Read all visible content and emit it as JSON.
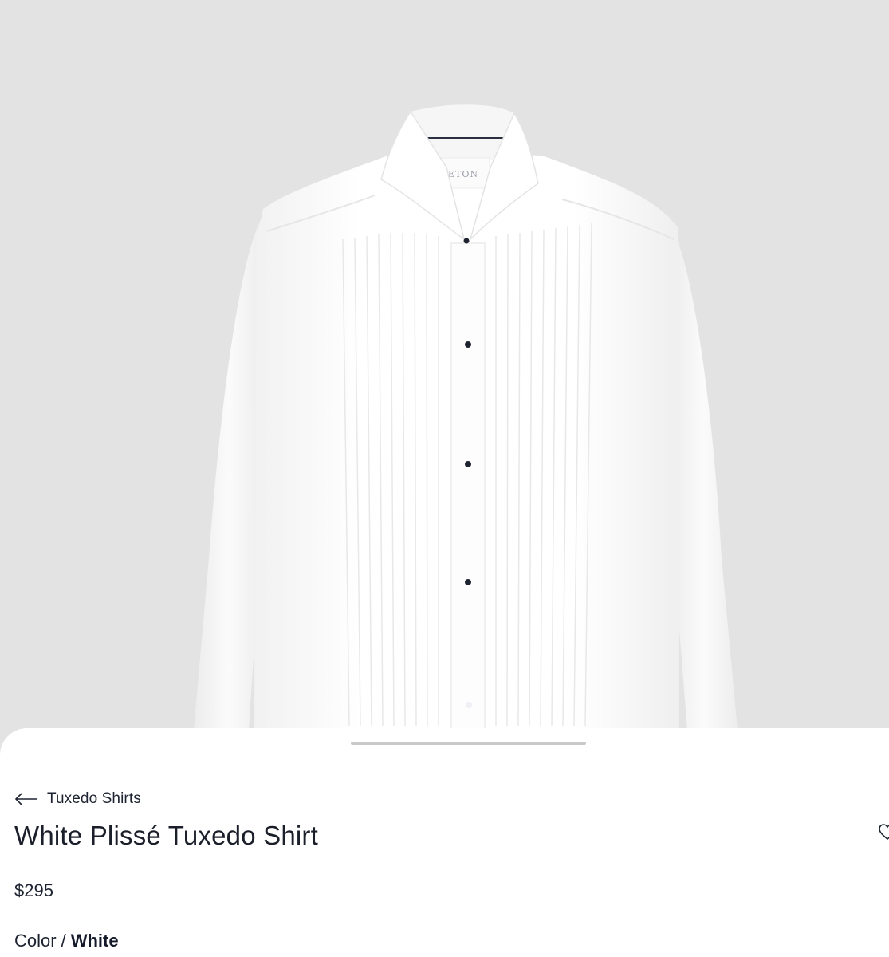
{
  "product_image": {
    "label_text": "ETON",
    "background_color": "#e3e3e3",
    "garment_color": "#ffffff",
    "stud_color": "#1e2330"
  },
  "breadcrumb": {
    "label": "Tuxedo Shirts",
    "icon": "arrow-left-icon"
  },
  "product": {
    "title": "White Plissé Tuxedo Shirt",
    "price": "$295",
    "color_label": "Color",
    "color_separator": "/",
    "color_value": "White"
  },
  "wishlist": {
    "icon": "heart-icon"
  }
}
